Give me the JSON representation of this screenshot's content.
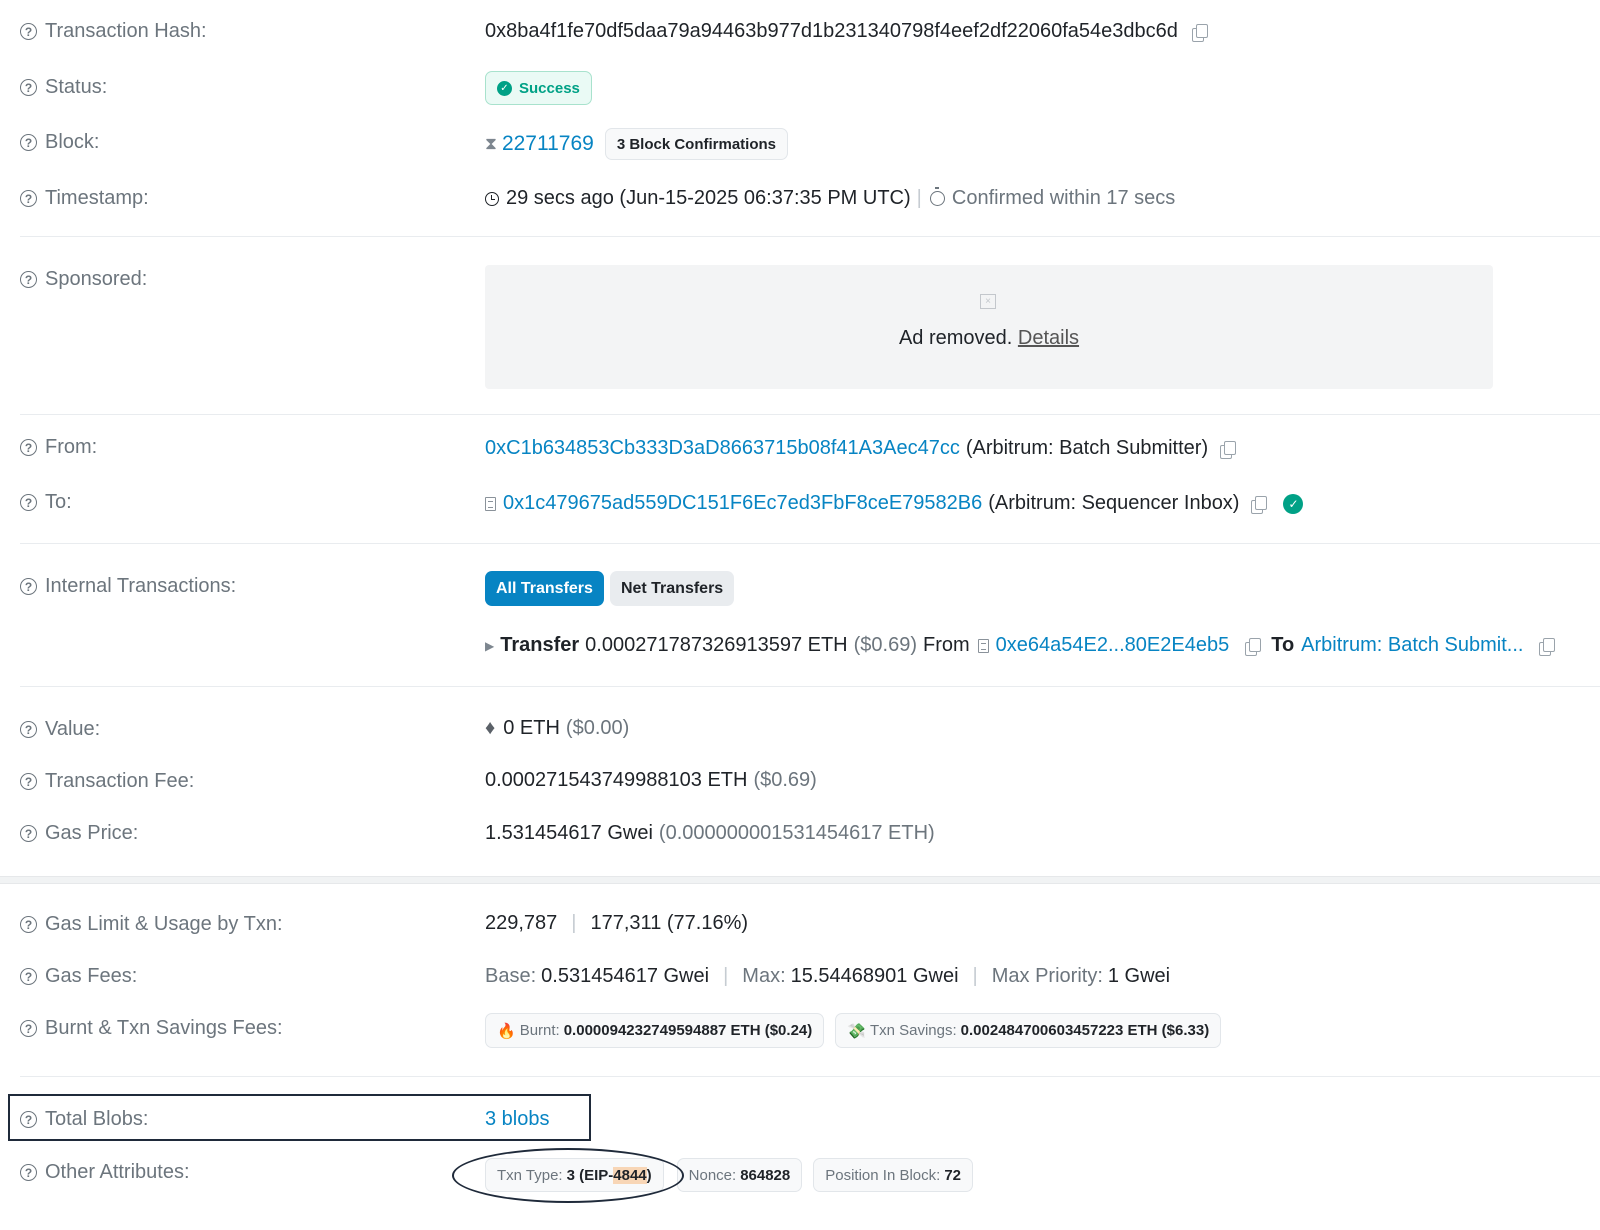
{
  "transaction_hash": {
    "label": "Transaction Hash:",
    "value": "0x8ba4f1fe70df5daa79a94463b977d1b231340798f4eef2df22060fa54e3dbc6d"
  },
  "status": {
    "label": "Status:",
    "value": "Success"
  },
  "block": {
    "label": "Block:",
    "number": "22711769",
    "confirmations": "3 Block Confirmations"
  },
  "timestamp": {
    "label": "Timestamp:",
    "value": "29 secs ago (Jun-15-2025 06:37:35 PM UTC)",
    "separator": "|",
    "confirmed": "Confirmed within 17 secs"
  },
  "sponsored": {
    "label": "Sponsored:",
    "ad_text": "Ad removed.",
    "details_link": "Details"
  },
  "from": {
    "label": "From:",
    "address": "0xC1b634853Cb333D3aD8663715b08f41A3Aec47cc",
    "name": "(Arbitrum: Batch Submitter)"
  },
  "to": {
    "label": "To:",
    "address": "0x1c479675ad559DC151F6Ec7ed3FbF8ceE79582B6",
    "name": "(Arbitrum: Sequencer Inbox)"
  },
  "internal_transactions": {
    "label": "Internal Transactions:",
    "tabs": [
      "All Transfers",
      "Net Transfers"
    ],
    "transfer": {
      "keyword": "Transfer",
      "amount": "0.000271787326913597 ETH",
      "usd": "($0.69)",
      "from_word": "From",
      "from_address": "0xe64a54E2...80E2E4eb5",
      "to_word": "To",
      "to_name": "Arbitrum: Batch Submit..."
    }
  },
  "value": {
    "label": "Value:",
    "eth": "0 ETH",
    "usd": "($0.00)"
  },
  "transaction_fee": {
    "label": "Transaction Fee:",
    "eth": "0.000271543749988103 ETH",
    "usd": "($0.69)"
  },
  "gas_price": {
    "label": "Gas Price:",
    "gwei": "1.531454617 Gwei",
    "eth": "(0.000000001531454617 ETH)"
  },
  "gas_limit": {
    "label": "Gas Limit & Usage by Txn:",
    "limit": "229,787",
    "separator": "|",
    "usage": "177,311 (77.16%)"
  },
  "gas_fees": {
    "label": "Gas Fees:",
    "base_key": "Base:",
    "base_val": "0.531454617 Gwei",
    "max_key": "Max:",
    "max_val": "15.54468901 Gwei",
    "priority_key": "Max Priority:",
    "priority_val": "1 Gwei",
    "separator": "|"
  },
  "burnt_savings": {
    "label": "Burnt & Txn Savings Fees:",
    "burnt_key": "Burnt:",
    "burnt_val": "0.000094232749594887 ETH ($0.24)",
    "savings_key": "Txn Savings:",
    "savings_val": "0.002484700603457223 ETH ($6.33)"
  },
  "total_blobs": {
    "label": "Total Blobs:",
    "value": "3 blobs"
  },
  "other_attributes": {
    "label": "Other Attributes:",
    "txn_type_key": "Txn Type:",
    "txn_type_val": "3 (EIP-",
    "txn_type_hl": "4844",
    "txn_type_end": ")",
    "nonce_key": "Nonce:",
    "nonce_val": "864828",
    "position_key": "Position In Block:",
    "position_val": "72"
  },
  "colors": {
    "link": "#0784c3",
    "success": "#00a186",
    "muted": "#6c757d"
  },
  "icons": [
    "help-icon",
    "copy-icon",
    "check-circle-icon",
    "hourglass-icon",
    "clock-icon",
    "stopwatch-icon",
    "ad-placeholder-icon",
    "contract-doc-icon",
    "verified-icon",
    "caret-right-icon",
    "ethereum-icon",
    "fire-icon",
    "money-wings-icon"
  ]
}
